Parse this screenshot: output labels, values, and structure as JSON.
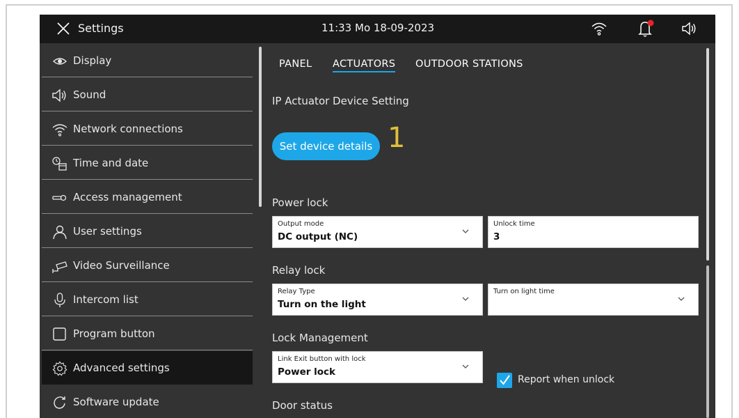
{
  "topbar": {
    "title": "Settings",
    "clock": "11:33  Mo 18-09-2023",
    "icons": [
      "close-icon",
      "wifi-icon",
      "bell-icon",
      "speaker-icon"
    ],
    "notification_color": "#e8242b"
  },
  "sidebar": {
    "items": [
      {
        "label": "Display",
        "icon": "eye-icon"
      },
      {
        "label": "Sound",
        "icon": "speaker-icon"
      },
      {
        "label": "Network connections",
        "icon": "wifi-icon"
      },
      {
        "label": "Time and date",
        "icon": "clock-calendar-icon"
      },
      {
        "label": "Access  management",
        "icon": "key-icon"
      },
      {
        "label": "User settings",
        "icon": "user-icon"
      },
      {
        "label": "Video Surveillance",
        "icon": "camera-icon"
      },
      {
        "label": "Intercom list",
        "icon": "microphone-icon"
      },
      {
        "label": "Program button",
        "icon": "square-icon"
      },
      {
        "label": "Advanced settings",
        "icon": "gear-icon",
        "active": true
      },
      {
        "label": "Software update",
        "icon": "refresh-icon"
      }
    ]
  },
  "tabs": [
    {
      "label": "PANEL"
    },
    {
      "label": "ACTUATORS",
      "active": true
    },
    {
      "label": "OUTDOOR STATIONS"
    }
  ],
  "main": {
    "section_ip": "IP Actuator Device Setting",
    "set_device_button": "Set device details",
    "step_number": "1",
    "power_lock": {
      "title": "Power lock",
      "output_mode_label": "Output mode",
      "output_mode_value": "DC output (NC)",
      "unlock_time_label": "Unlock time",
      "unlock_time_value": "3"
    },
    "relay_lock": {
      "title": "Relay lock",
      "relay_type_label": "Relay Type",
      "relay_type_value": "Turn on the light",
      "light_time_label": "Turn on light time",
      "light_time_value": ""
    },
    "lock_management": {
      "title": "Lock Management",
      "link_exit_label": "Link Exit button with lock",
      "link_exit_value": "Power lock",
      "report_unlock_label": "Report when unlock",
      "report_unlock_checked": true
    },
    "door_status_title": "Door status"
  },
  "colors": {
    "accent": "#1ea7e8",
    "topbar_bg": "#181818",
    "panel_bg": "#333333",
    "active_item_bg": "#161616",
    "step_number": "#e0bf3a"
  }
}
